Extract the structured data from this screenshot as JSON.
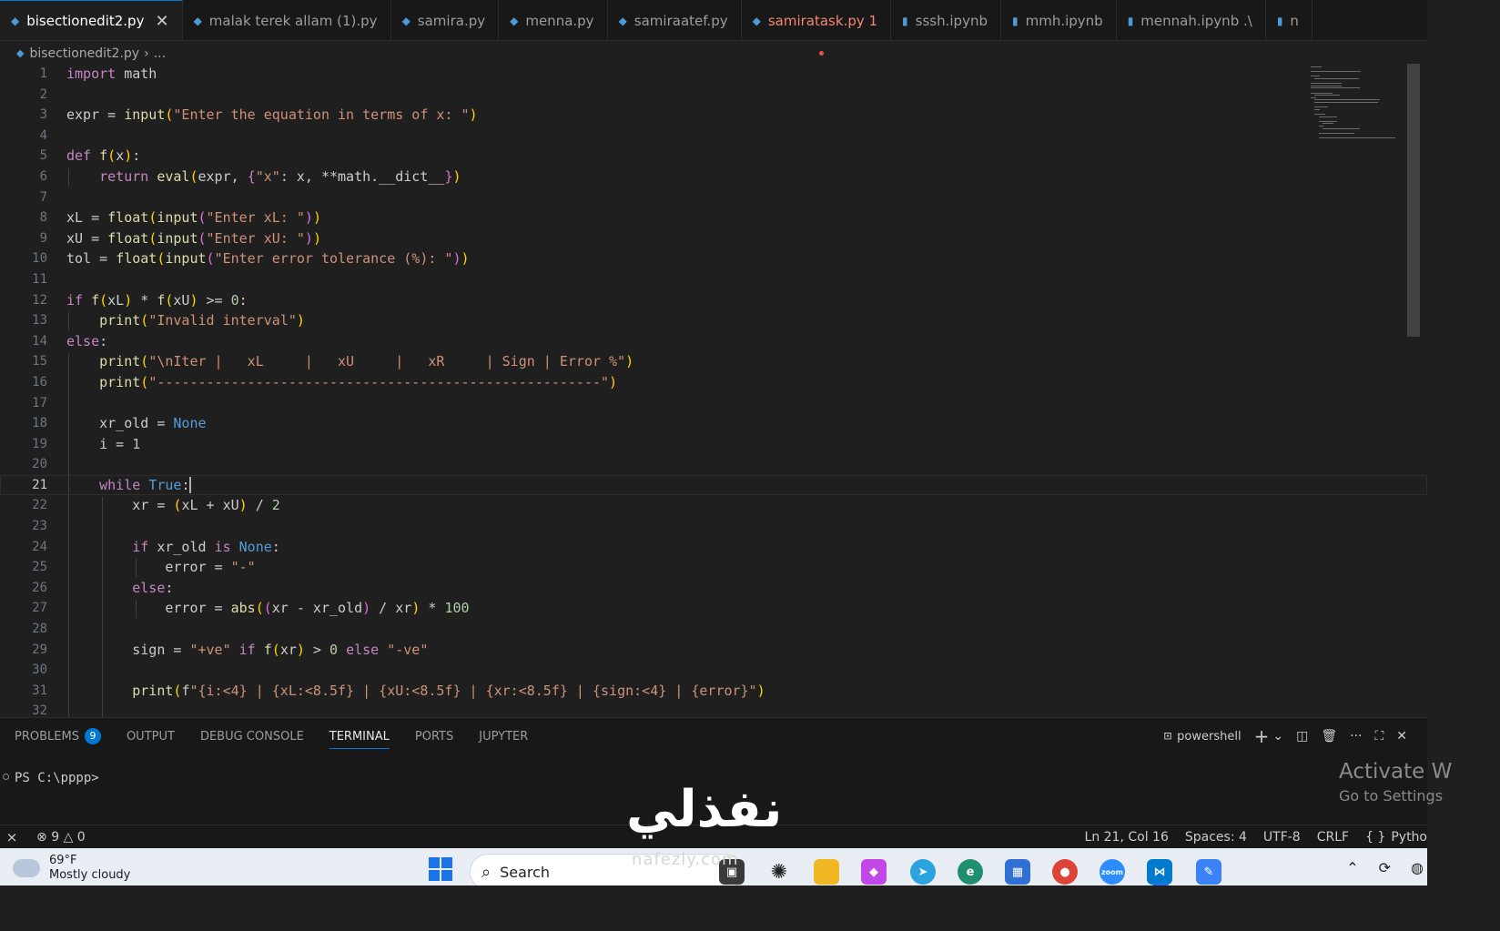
{
  "tabs": [
    {
      "label": "bisectionedit2.py",
      "kind": "py",
      "active": true,
      "close": "✕"
    },
    {
      "label": "malak terek allam (1).py",
      "kind": "py"
    },
    {
      "label": "samira.py",
      "kind": "py"
    },
    {
      "label": "menna.py",
      "kind": "py"
    },
    {
      "label": "samiraatef.py",
      "kind": "py"
    },
    {
      "label": "samiratask.py 1",
      "kind": "py",
      "error": true
    },
    {
      "label": "sssh.ipynb",
      "kind": "nb"
    },
    {
      "label": "mmh.ipynb",
      "kind": "nb"
    },
    {
      "label": "mennah.ipynb .\\",
      "kind": "nb"
    },
    {
      "label": "n",
      "kind": "nb"
    }
  ],
  "breadcrumb": {
    "file": "bisectionedit2.py",
    "sep": "›",
    "more": "..."
  },
  "editor": {
    "current_line": 21,
    "line_numbers": [
      "1",
      "2",
      "3",
      "4",
      "5",
      "6",
      "7",
      "8",
      "9",
      "10",
      "11",
      "12",
      "13",
      "14",
      "15",
      "16",
      "17",
      "18",
      "19",
      "20",
      "21",
      "22",
      "23",
      "24",
      "25",
      "26",
      "27",
      "28",
      "29",
      "30",
      "31",
      "32"
    ],
    "lines": [
      "import math",
      "",
      "expr = input(\"Enter the equation in terms of x: \")",
      "",
      "def f(x):",
      "    return eval(expr, {\"x\": x, **math.__dict__})",
      "",
      "xL = float(input(\"Enter xL: \"))",
      "xU = float(input(\"Enter xU: \"))",
      "tol = float(input(\"Enter error tolerance (%): \"))",
      "",
      "if f(xL) * f(xU) >= 0:",
      "    print(\"Invalid interval\")",
      "else:",
      "    print(\"\\nIter |   xL     |   xU     |   xR     | Sign | Error %\")",
      "    print(\"------------------------------------------------------\")",
      "",
      "    xr_old = None",
      "    i = 1",
      "",
      "    while True:",
      "        xr = (xL + xU) / 2",
      "",
      "        if xr_old is None:",
      "            error = \"-\"",
      "        else:",
      "            error = abs((xr - xr_old) / xr) * 100",
      "",
      "        sign = \"+ve\" if f(xr) > 0 else \"-ve\"",
      "",
      "        print(f\"{i:<4} | {xL:<8.5f} | {xU:<8.5f} | {xr:<8.5f} | {sign:<4} | {error}\")",
      ""
    ]
  },
  "panel": {
    "tabs": [
      {
        "label": "PROBLEMS",
        "badge": "9"
      },
      {
        "label": "OUTPUT"
      },
      {
        "label": "DEBUG CONSOLE"
      },
      {
        "label": "TERMINAL",
        "active": true
      },
      {
        "label": "PORTS"
      },
      {
        "label": "JUPYTER"
      }
    ],
    "shell": "powershell",
    "tools": [
      "+",
      "⌄",
      "◫",
      "🗑",
      "···",
      "⛶",
      "✕"
    ],
    "terminal_prompt": "PS C:\\pppp>",
    "activate_title": "Activate W",
    "activate_sub": "Go to Settings"
  },
  "status": {
    "errors": "9",
    "warnings": "0",
    "position": "Ln 21, Col 16",
    "spaces": "Spaces: 4",
    "encoding": "UTF-8",
    "eol": "CRLF",
    "language": "Pytho"
  },
  "watermark": {
    "text": "نفذلي",
    "sub": "nafezly.com"
  },
  "taskbar": {
    "temperature": "69°F",
    "condition": "Mostly cloudy",
    "search_placeholder": "Search"
  },
  "colors": {
    "accent": "#0078d4",
    "error": "#f48771",
    "background": "#1f1f1f"
  }
}
